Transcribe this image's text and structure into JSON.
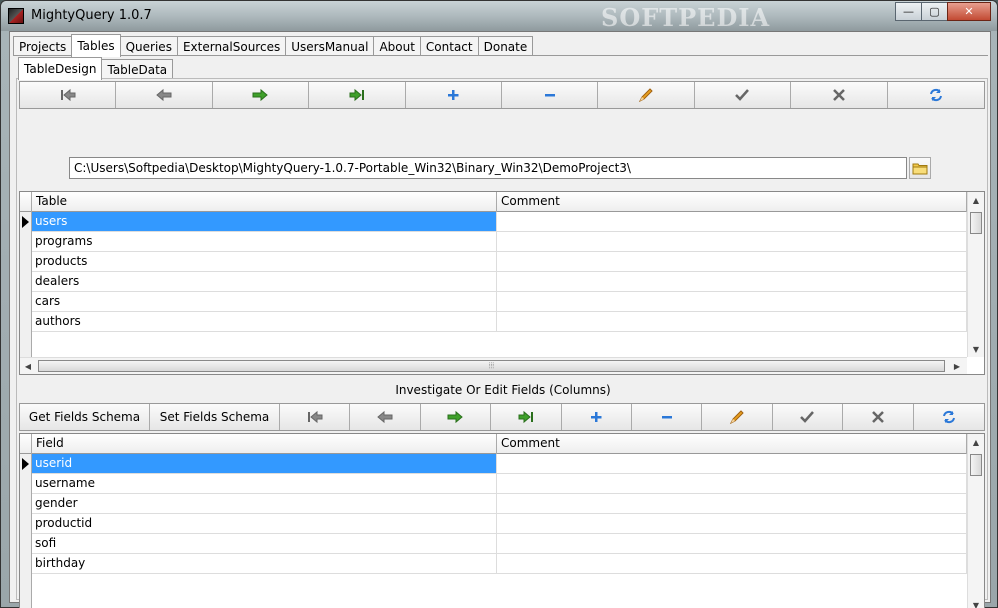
{
  "window": {
    "title": "MightyQuery 1.0.7",
    "watermark": "SOFTPEDIA",
    "minimize_glyph": "—",
    "maximize_glyph": "▢",
    "close_glyph": "✕"
  },
  "main_tabs": [
    {
      "label": "Projects",
      "active": false
    },
    {
      "label": "Tables",
      "active": true
    },
    {
      "label": "Queries",
      "active": false
    },
    {
      "label": "ExternalSources",
      "active": false
    },
    {
      "label": "UsersManual",
      "active": false
    },
    {
      "label": "About",
      "active": false
    },
    {
      "label": "Contact",
      "active": false
    },
    {
      "label": "Donate",
      "active": false
    }
  ],
  "sub_tabs": [
    {
      "label": "TableDesign",
      "active": true
    },
    {
      "label": "TableData",
      "active": false
    }
  ],
  "nav_icons": [
    "first-icon",
    "prior-icon",
    "next-icon",
    "last-icon",
    "insert-icon",
    "delete-icon",
    "edit-icon",
    "post-icon",
    "cancel-icon",
    "refresh-icon"
  ],
  "colors": {
    "green": "#3fa02a",
    "blue": "#2b78d8",
    "gray": "#666666",
    "pencil": "#e8a020",
    "selection": "#3399ff"
  },
  "path": {
    "value": "C:\\Users\\Softpedia\\Desktop\\MightyQuery-1.0.7-Portable_Win32\\Binary_Win32\\DemoProject3\\"
  },
  "tables_grid": {
    "columns": [
      "Table",
      "Comment"
    ],
    "rows": [
      {
        "name": "users",
        "comment": ""
      },
      {
        "name": "programs",
        "comment": ""
      },
      {
        "name": "products",
        "comment": ""
      },
      {
        "name": "dealers",
        "comment": ""
      },
      {
        "name": "cars",
        "comment": ""
      },
      {
        "name": "authors",
        "comment": ""
      }
    ],
    "selected_row": 0
  },
  "fields_section": {
    "label": "Investigate Or Edit Fields (Columns)",
    "get_schema_label": "Get Fields Schema",
    "set_schema_label": "Set Fields Schema"
  },
  "fields_grid": {
    "columns": [
      "Field",
      "Comment"
    ],
    "rows": [
      {
        "name": "userid",
        "comment": ""
      },
      {
        "name": "username",
        "comment": ""
      },
      {
        "name": "gender",
        "comment": ""
      },
      {
        "name": "productid",
        "comment": ""
      },
      {
        "name": "sofi",
        "comment": ""
      },
      {
        "name": "birthday",
        "comment": ""
      }
    ],
    "selected_row": 0
  },
  "scroll_glyphs": {
    "up": "▲",
    "down": "▼",
    "left": "◀",
    "right": "▶",
    "grip": "⦙⦙⦙"
  }
}
